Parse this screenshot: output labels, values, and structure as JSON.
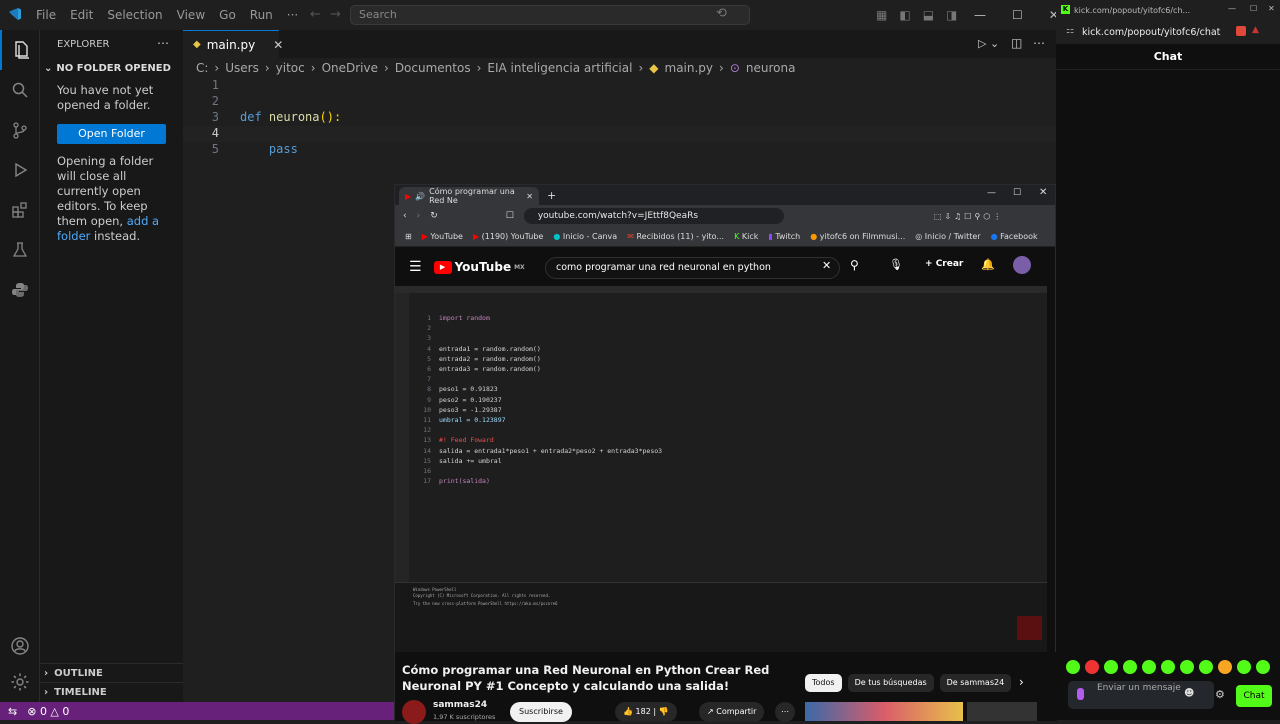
{
  "vscode": {
    "menu": [
      "File",
      "Edit",
      "Selection",
      "View",
      "Go",
      "Run",
      "···"
    ],
    "search_placeholder": "Search",
    "explorer_title": "EXPLORER",
    "no_folder": "NO FOLDER OPENED",
    "no_folder_msg": "You have not yet opened a folder.",
    "open_folder": "Open Folder",
    "info_msg_1": "Opening a folder will close all currently open editors. To keep them open,",
    "add_folder_link": "add a folder",
    "info_msg_2": "instead.",
    "outline": "OUTLINE",
    "timeline": "TIMELINE",
    "tab_name": "main.py",
    "breadcrumb": [
      "C:",
      "Users",
      "yitoc",
      "OneDrive",
      "Documentos",
      "EIA inteligencia artificial",
      "main.py",
      "neurona"
    ],
    "code_lines": [
      {
        "n": "1",
        "t": ""
      },
      {
        "n": "2",
        "t": ""
      },
      {
        "n": "3",
        "t": "def neurona():"
      },
      {
        "n": "4",
        "t": ""
      },
      {
        "n": "5",
        "t": "    pass"
      }
    ],
    "status_errors": "0",
    "status_warnings": "0"
  },
  "browser": {
    "tab_title": "Cómo programar una Red Ne",
    "url": "youtube.com/watch?v=JEttf8QeaRs",
    "bookmarks": [
      "YouTube",
      "(1190) YouTube",
      "Inicio - Canva",
      "Recibidos (11) - yito...",
      "Kick",
      "Twitch",
      "yitofc6 on Filmmusi...",
      "Inicio / Twitter",
      "Facebook"
    ],
    "yt_logo": "YouTube",
    "yt_region": "MX",
    "yt_search": "como programar una red neuronal en python",
    "create_label": "Crear",
    "video_code": [
      {
        "n": "1",
        "t": "import random"
      },
      {
        "n": "2",
        "t": ""
      },
      {
        "n": "3",
        "t": ""
      },
      {
        "n": "4",
        "t": "entrada1 = random.random()"
      },
      {
        "n": "5",
        "t": "entrada2 = random.random()"
      },
      {
        "n": "6",
        "t": "entrada3 = random.random()"
      },
      {
        "n": "7",
        "t": ""
      },
      {
        "n": "8",
        "t": "peso1 = 0.91823"
      },
      {
        "n": "9",
        "t": "peso2 = 0.190237"
      },
      {
        "n": "10",
        "t": "peso3 = -1.29387"
      },
      {
        "n": "11",
        "t": "umbral = 0.123897"
      },
      {
        "n": "12",
        "t": ""
      },
      {
        "n": "13",
        "t": "#! Feed Foward"
      },
      {
        "n": "14",
        "t": "salida = entrada1*peso1 + entrada2*peso2 + entrada3*peso3"
      },
      {
        "n": "15",
        "t": "salida += umbral"
      },
      {
        "n": "16",
        "t": ""
      },
      {
        "n": "17",
        "t": "print(salida)"
      }
    ],
    "video_term": [
      "Windows PowerShell",
      "Copyright (C) Microsoft Corporation. All rights reserved.",
      "Try the new cross-platform PowerShell https://aka.ms/pscore6"
    ],
    "video_title": "Cómo programar una Red Neuronal en Python Crear Red Neuronal PY #1 Concepto y calculando una salida!",
    "channel": "sammas24",
    "subscribers": "1,97 K suscriptores",
    "subscribe": "Suscribirse",
    "likes": "182",
    "share": "Compartir",
    "chips": [
      "Todos",
      "De tus búsquedas",
      "De sammas24"
    ]
  },
  "kick": {
    "window_title": "kick.com/popout/yitofc6/ch...",
    "address": "kick.com/popout/yitofc6/chat",
    "chat_title": "Chat",
    "input_placeholder": "Enviar un mensaje",
    "send_label": "Chat",
    "accent": "#53fc18"
  }
}
